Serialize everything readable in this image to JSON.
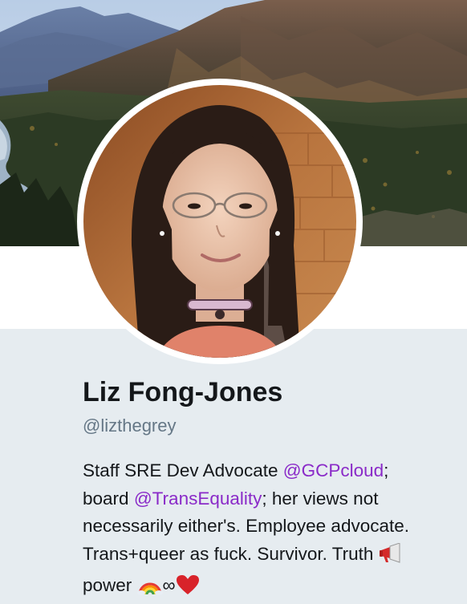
{
  "profile": {
    "name": "Liz Fong-Jones",
    "handle": "@lizthegrey"
  },
  "bio": {
    "l1_text": "Staff SRE Dev Advocate ",
    "l1_mention": "@GCPcloud",
    "l1_tail": ";",
    "l2_text": "board ",
    "l2_mention": "@TransEquality",
    "l2_tail": "; her views not",
    "l3_text": "necessarily either's. Employee advocate.",
    "l4_text": "Trans+queer as fuck. Survivor. Truth ",
    "l5_text": "power ",
    "infinity": "∞"
  },
  "icons": {
    "megaphone": "megaphone-emoji",
    "rainbow": "rainbow-emoji",
    "heart": "red-heart-emoji"
  },
  "colors": {
    "background": "#e6ecf0",
    "mention": "#8a2ac8",
    "name": "#14171a",
    "handle": "#657786",
    "heart": "#d8232a"
  }
}
